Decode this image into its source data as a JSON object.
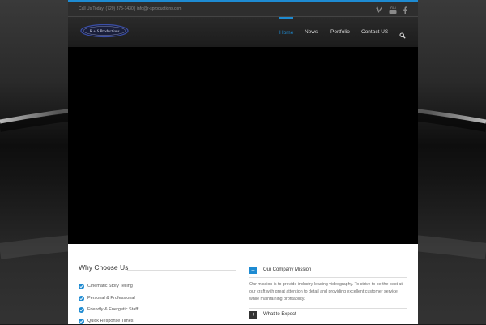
{
  "topbar": {
    "contact_text": "Call Us Today! (720) 375-1430  |  info@r-sproductions.com",
    "social": [
      {
        "name": "vimeo-icon"
      },
      {
        "name": "youtube-icon"
      },
      {
        "name": "facebook-icon"
      }
    ]
  },
  "header": {
    "logo_text": "R + S Productions",
    "nav": [
      {
        "label": "Home",
        "active": true
      },
      {
        "label": "News",
        "active": false
      },
      {
        "label": "Portfolio",
        "active": false
      },
      {
        "label": "Contact US",
        "active": false
      }
    ],
    "search_icon": "search-icon"
  },
  "why": {
    "title": "Why Choose Us",
    "items": [
      "Cinematic Story Telling",
      "Personal & Professional",
      "Friendly & Energetic Staff",
      "Quick Response Times"
    ]
  },
  "accordion": {
    "open_title": "Our Company Mission",
    "open_text": "Our mission is to provide industry leading videography. To strive to be the best at our craft with great attention to detail and providing excellent customer service while maintaining profitability.",
    "closed_title": "What to Expect"
  },
  "colors": {
    "accent": "#1e8bd2",
    "dark_toggle": "#333333"
  }
}
